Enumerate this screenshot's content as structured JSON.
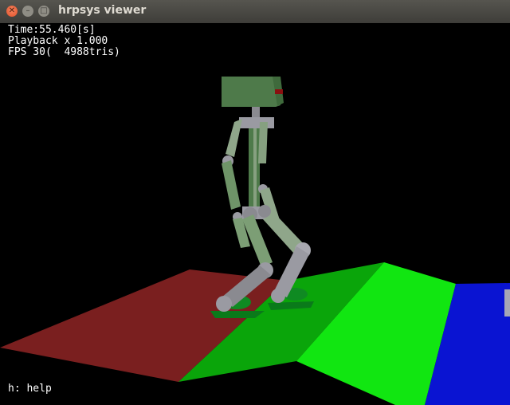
{
  "window": {
    "title": "hrpsys viewer",
    "buttons": {
      "close": "✕",
      "minimize": "–",
      "maximize": "□"
    }
  },
  "hud": {
    "time": "Time:55.460[s]",
    "playback": "Playback x 1.000",
    "fps": "FPS 30(  4988tris)",
    "help": "h: help"
  },
  "scene": {
    "colors": {
      "floor_red": "#7a1f1f",
      "floor_dark_green": "#0aa50a",
      "floor_green": "#11e611",
      "floor_blue": "#0a14d2",
      "robot_body": "#4e7a4a",
      "robot_joint": "#a0a0a8"
    }
  }
}
